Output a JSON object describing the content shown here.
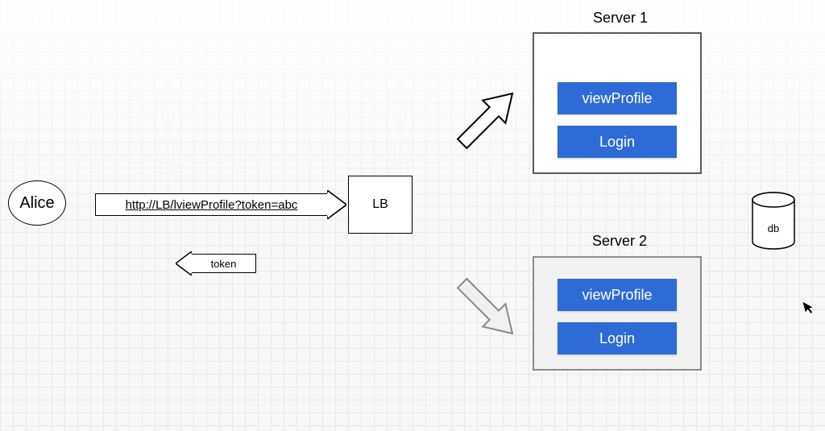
{
  "nodes": {
    "alice": "Alice",
    "lb": "LB",
    "db": "db"
  },
  "servers": {
    "server1": {
      "label": "Server 1",
      "buttons": [
        "viewProfile",
        "Login"
      ]
    },
    "server2": {
      "label": "Server 2",
      "buttons": [
        "viewProfile",
        "Login"
      ]
    }
  },
  "arrows": {
    "request_url": "http://LB/lviewProfile?token=abc",
    "response_token": "token"
  }
}
